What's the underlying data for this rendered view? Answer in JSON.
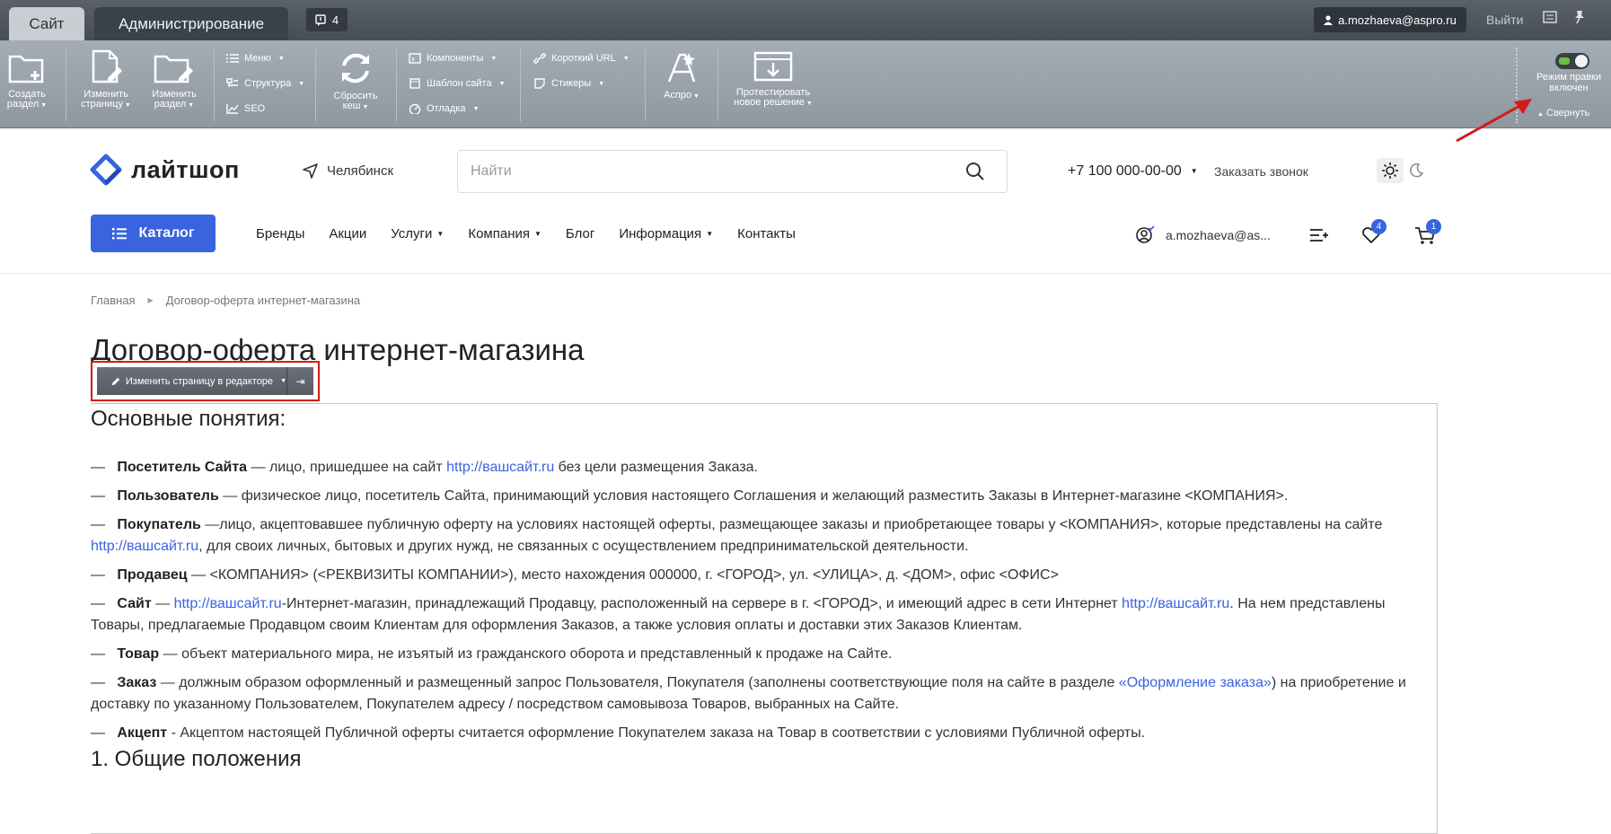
{
  "admin": {
    "tab_site": "Сайт",
    "tab_admin": "Администрирование",
    "notifications": "4",
    "user": "a.mozhaeva@aspro.ru",
    "logout": "Выйти",
    "buttons": {
      "create_section": [
        "Создать",
        "раздел"
      ],
      "edit_page": [
        "Изменить",
        "страницу"
      ],
      "edit_section": [
        "Изменить",
        "раздел"
      ],
      "menu": "Меню",
      "structure": "Структура",
      "seo": "SEO",
      "reset_cache": [
        "Сбросить",
        "кеш"
      ],
      "components": "Компоненты",
      "site_template": "Шаблон сайта",
      "debug": "Отладка",
      "short_url": "Короткий URL",
      "stickers": "Стикеры",
      "aspro": "Аспро",
      "test_solution": [
        "Протестировать",
        "новое решение"
      ]
    },
    "edit_mode": [
      "Режим правки",
      "включен"
    ],
    "collapse": "Свернуть"
  },
  "header": {
    "logo": "лайтшоп",
    "city": "Челябинск",
    "search_placeholder": "Найти",
    "phone": "+7 100 000-00-00",
    "callback": "Заказать звонок",
    "catalog": "Каталог",
    "nav": [
      "Бренды",
      "Акции",
      "Услуги",
      "Компания",
      "Блог",
      "Информация",
      "Контакты"
    ],
    "user": "a.mozhaeva@as...",
    "fav_count": "4",
    "cart_count": "1"
  },
  "breadcrumb": [
    "Главная",
    "Договор-оферта интернет-магазина"
  ],
  "page": {
    "title": "Договор-оферта интернет-магазина",
    "edit_in_editor": "Изменить страницу в редакторе",
    "section_title": "Основные понятия:",
    "terms": [
      {
        "term": "Посетитель Сайта",
        "pre": " — лицо, пришедшее на сайт ",
        "link": "http://вашсайт.ru",
        "post": " без цели размещения Заказа."
      },
      {
        "term": "Пользователь",
        "pre": " — физическое лицо, посетитель Сайта, принимающий условия настоящего Соглашения и желающий разместить Заказы в Интернет-магазине <КОМПАНИЯ>."
      },
      {
        "term": "Покупатель",
        "pre": " —лицо, акцептовавшее публичную оферту на условиях настоящей оферты, размещающее заказы и приобретающее товары у <КОМПАНИЯ>, которые представлены на сайте ",
        "link": "http://вашсайт.ru",
        "post": ", для своих личных, бытовых и других нужд, не связанных с осуществлением предпринимательской деятельности."
      },
      {
        "term": "Продавец",
        "pre": " — <КОМПАНИЯ> (<РЕКВИЗИТЫ КОМПАНИИ>), место нахождения 000000, г. <ГОРОД>, ул. <УЛИЦА>, д. <ДОМ>, офис <ОФИС>"
      },
      {
        "term": "Сайт",
        "pre": " — ",
        "link": "http://вашсайт.ru",
        "post": "-Интернет-магазин, принадлежащий Продавцу, расположенный на сервере в г. <ГОРОД>, и имеющий адрес в сети Интернет ",
        "link2": "http://вашсайт.ru",
        "post2": ". На нем представлены Товары, предлагаемые Продавцом своим Клиентам для оформления Заказов, а также условия оплаты и доставки этих Заказов Клиентам."
      },
      {
        "term": "Товар",
        "pre": " — объект материального мира, не изъятый из гражданского оборота и представленный к продаже на Сайте."
      },
      {
        "term": "Заказ",
        "pre": " — должным образом оформленный и размещенный запрос Пользователя, Покупателя (заполнены соответствующие поля на сайте в разделе ",
        "link": "«Оформление заказа»",
        "post": ") на приобретение и доставку по указанному Пользователем, Покупателем адресу / посредством самовывоза Товаров, выбранных на Сайте."
      },
      {
        "term": "Акцепт",
        "pre": " - Акцептом настоящей Публичной оферты считается оформление Покупателем заказа на Товар в соответствии с условиями Публичной оферты."
      }
    ],
    "section1": "1. Общие положения"
  }
}
